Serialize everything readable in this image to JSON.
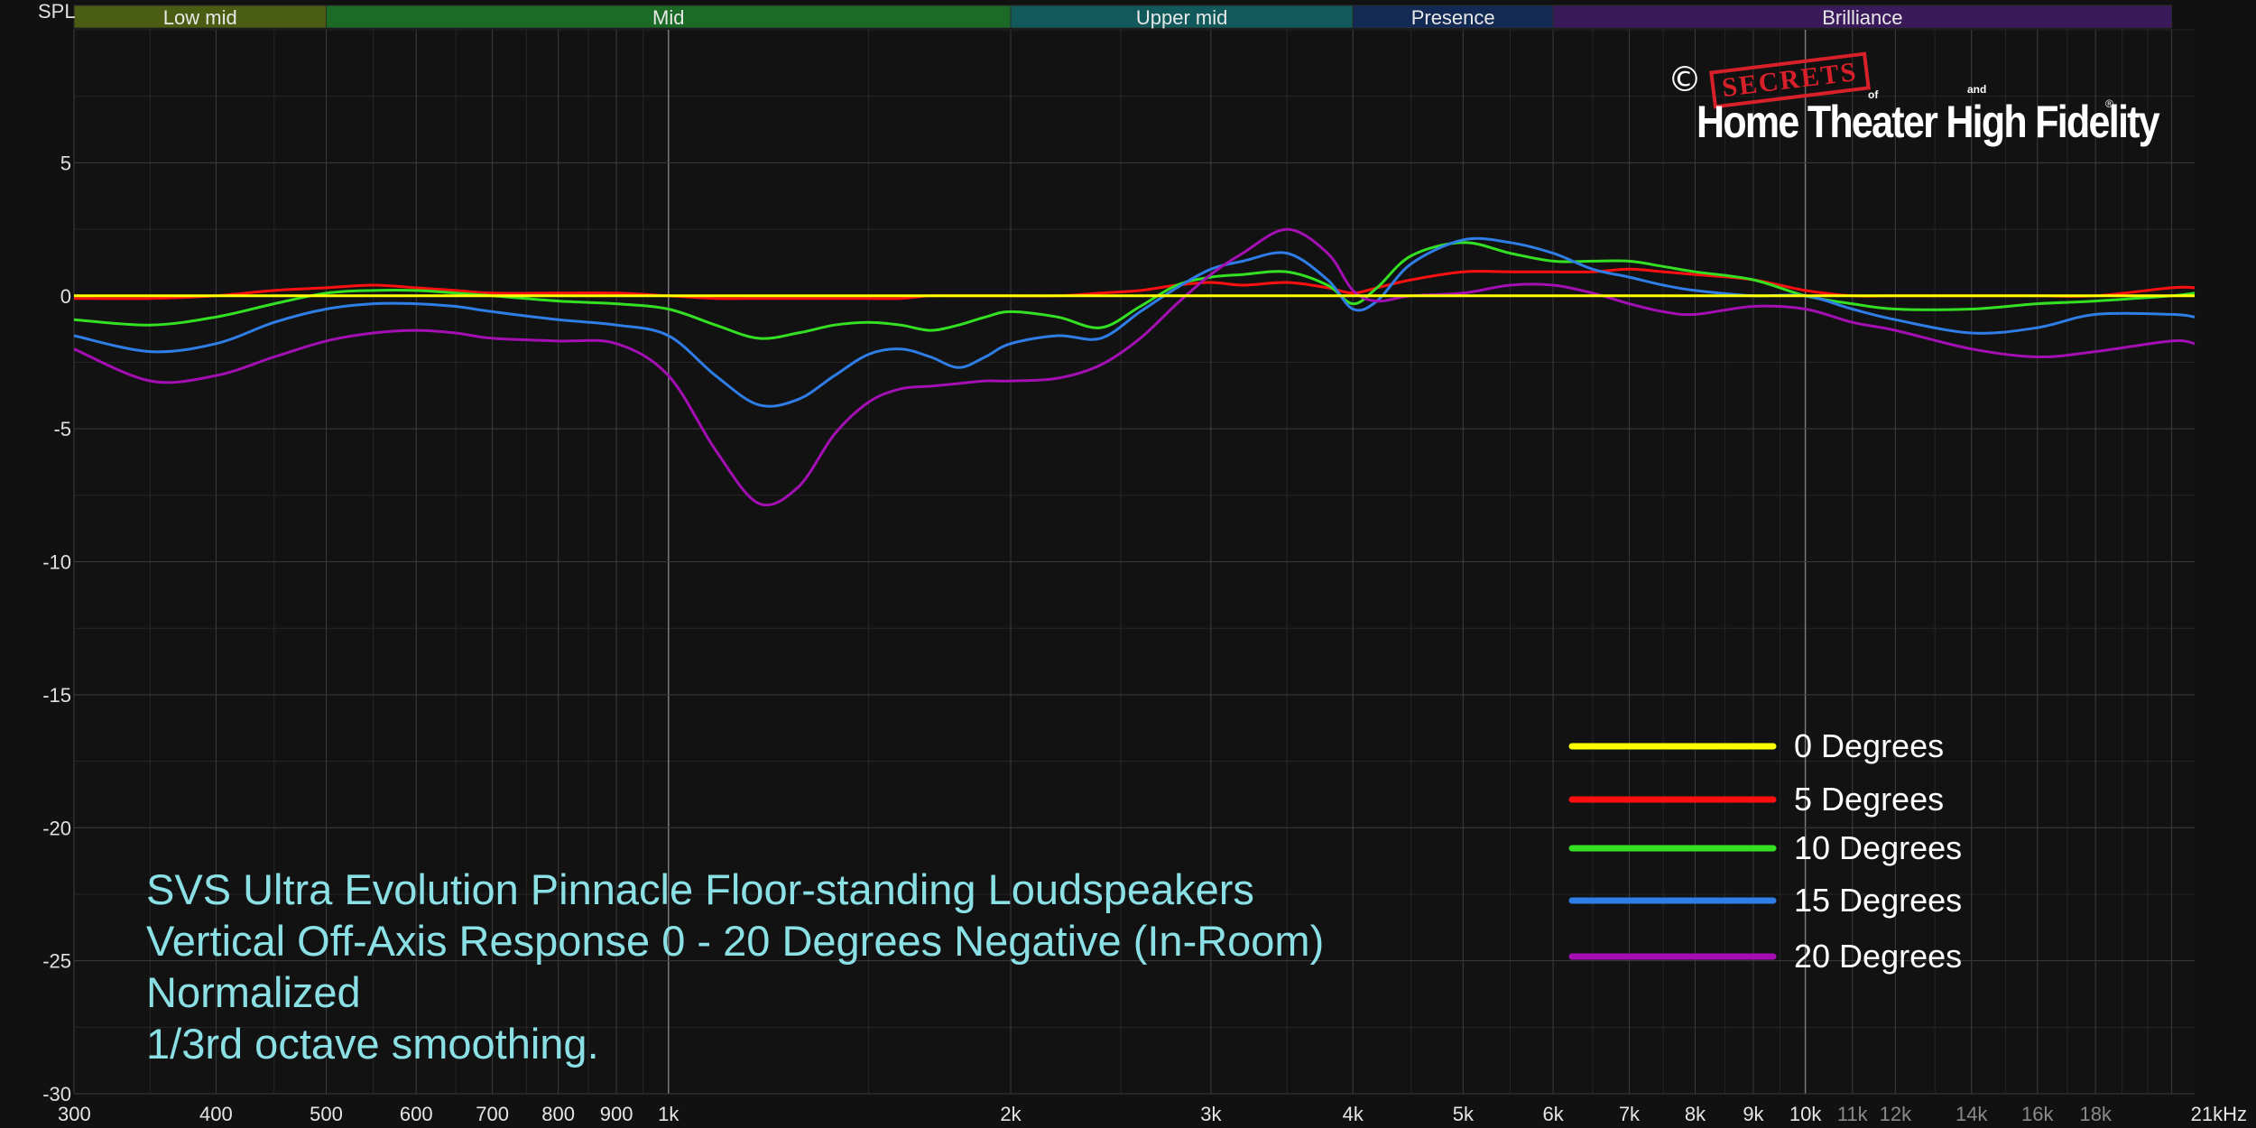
{
  "chart_data": {
    "type": "line",
    "ylabel": "SPL",
    "x_scale": "log",
    "xlim": [
      300,
      22000
    ],
    "ylim": [
      -30,
      10
    ],
    "grid": true,
    "x_ticks": [
      {
        "v": 300,
        "label": "300",
        "major": true
      },
      {
        "v": 400,
        "label": "400",
        "major": true
      },
      {
        "v": 500,
        "label": "500",
        "major": true
      },
      {
        "v": 600,
        "label": "600",
        "major": true
      },
      {
        "v": 700,
        "label": "700",
        "major": true
      },
      {
        "v": 800,
        "label": "800",
        "major": true
      },
      {
        "v": 900,
        "label": "900",
        "major": true
      },
      {
        "v": 1000,
        "label": "1k",
        "major": true
      },
      {
        "v": 2000,
        "label": "2k",
        "major": true
      },
      {
        "v": 3000,
        "label": "3k",
        "major": true
      },
      {
        "v": 4000,
        "label": "4k",
        "major": true
      },
      {
        "v": 5000,
        "label": "5k",
        "major": true
      },
      {
        "v": 6000,
        "label": "6k",
        "major": true
      },
      {
        "v": 7000,
        "label": "7k",
        "major": true
      },
      {
        "v": 8000,
        "label": "8k",
        "major": true
      },
      {
        "v": 9000,
        "label": "9k",
        "major": true
      },
      {
        "v": 10000,
        "label": "10k",
        "major": true
      },
      {
        "v": 11000,
        "label": "11k",
        "major": false
      },
      {
        "v": 12000,
        "label": "12k",
        "major": false
      },
      {
        "v": 14000,
        "label": "14k",
        "major": false
      },
      {
        "v": 16000,
        "label": "16k",
        "major": false
      },
      {
        "v": 18000,
        "label": "18k",
        "major": false
      },
      {
        "v": 21000,
        "label": "21kHz",
        "major": true
      }
    ],
    "y_ticks": [
      {
        "v": 5,
        "label": "5"
      },
      {
        "v": 0,
        "label": "0"
      },
      {
        "v": -5,
        "label": "-5"
      },
      {
        "v": -10,
        "label": "-10"
      },
      {
        "v": -15,
        "label": "-15"
      },
      {
        "v": -20,
        "label": "-20"
      },
      {
        "v": -25,
        "label": "-25"
      },
      {
        "v": -30,
        "label": "-30"
      }
    ],
    "bands": [
      {
        "label": "Low mid",
        "from": 300,
        "to": 500,
        "color": "#4a5d12"
      },
      {
        "label": "Mid",
        "from": 500,
        "to": 2000,
        "color": "#1b6a26"
      },
      {
        "label": "Upper mid",
        "from": 2000,
        "to": 4000,
        "color": "#11595a"
      },
      {
        "label": "Presence",
        "from": 4000,
        "to": 6000,
        "color": "#132a55"
      },
      {
        "label": "Brilliance",
        "from": 6000,
        "to": 21000,
        "color": "#3a1a5a"
      }
    ],
    "x": [
      300,
      350,
      400,
      450,
      500,
      550,
      600,
      650,
      700,
      800,
      900,
      1000,
      1100,
      1200,
      1300,
      1400,
      1500,
      1600,
      1700,
      1800,
      1900,
      2000,
      2200,
      2400,
      2600,
      2800,
      3000,
      3200,
      3500,
      3800,
      4000,
      4200,
      4500,
      5000,
      5500,
      6000,
      6500,
      7000,
      7500,
      8000,
      9000,
      10000,
      11000,
      12000,
      14000,
      16000,
      18000,
      21000,
      22000
    ],
    "series": [
      {
        "name": "0 Degrees",
        "color": "#ffff00",
        "values": [
          0,
          0,
          0,
          0,
          0,
          0,
          0,
          0,
          0,
          0,
          0,
          0,
          0,
          0,
          0,
          0,
          0,
          0,
          0,
          0,
          0,
          0,
          0,
          0,
          0,
          0,
          0,
          0,
          0,
          0,
          0,
          0,
          0,
          0,
          0,
          0,
          0,
          0,
          0,
          0,
          0,
          0,
          0,
          0,
          0,
          0,
          0,
          0,
          0
        ]
      },
      {
        "name": "5 Degrees",
        "color": "#ff1010",
        "values": [
          -0.1,
          -0.1,
          0.0,
          0.2,
          0.3,
          0.4,
          0.3,
          0.2,
          0.1,
          0.1,
          0.1,
          0.0,
          -0.1,
          -0.1,
          -0.1,
          -0.1,
          -0.1,
          -0.1,
          0.0,
          0.0,
          0.0,
          0.0,
          0.0,
          0.1,
          0.2,
          0.4,
          0.5,
          0.4,
          0.5,
          0.3,
          0.1,
          0.3,
          0.6,
          0.9,
          0.9,
          0.9,
          0.9,
          1.0,
          0.9,
          0.8,
          0.6,
          0.2,
          0.0,
          0.0,
          0.0,
          0.0,
          0.0,
          0.3,
          0.3
        ]
      },
      {
        "name": "10 Degrees",
        "color": "#33e022",
        "values": [
          -0.9,
          -1.1,
          -0.8,
          -0.3,
          0.1,
          0.2,
          0.2,
          0.1,
          0.0,
          -0.2,
          -0.3,
          -0.5,
          -1.1,
          -1.6,
          -1.4,
          -1.1,
          -1.0,
          -1.1,
          -1.3,
          -1.1,
          -0.8,
          -0.6,
          -0.8,
          -1.2,
          -0.4,
          0.4,
          0.7,
          0.8,
          0.9,
          0.4,
          -0.3,
          0.3,
          1.5,
          2.0,
          1.6,
          1.3,
          1.3,
          1.3,
          1.1,
          0.9,
          0.6,
          0.0,
          -0.3,
          -0.5,
          -0.5,
          -0.3,
          -0.2,
          0.0,
          0.1
        ]
      },
      {
        "name": "15 Degrees",
        "color": "#2f7de6",
        "values": [
          -1.5,
          -2.1,
          -1.8,
          -1.0,
          -0.5,
          -0.3,
          -0.3,
          -0.4,
          -0.6,
          -0.9,
          -1.1,
          -1.5,
          -3.0,
          -4.1,
          -3.9,
          -3.0,
          -2.2,
          -2.0,
          -2.3,
          -2.7,
          -2.3,
          -1.8,
          -1.5,
          -1.6,
          -0.6,
          0.3,
          1.0,
          1.3,
          1.6,
          0.6,
          -0.5,
          -0.2,
          1.2,
          2.1,
          2.0,
          1.6,
          1.0,
          0.7,
          0.4,
          0.2,
          0.0,
          0.0,
          -0.5,
          -0.9,
          -1.4,
          -1.2,
          -0.7,
          -0.7,
          -0.8
        ]
      },
      {
        "name": "20 Degrees",
        "color": "#a40fb4",
        "values": [
          -2.0,
          -3.2,
          -3.0,
          -2.3,
          -1.7,
          -1.4,
          -1.3,
          -1.4,
          -1.6,
          -1.7,
          -1.8,
          -3.0,
          -5.8,
          -7.8,
          -7.2,
          -5.2,
          -4.0,
          -3.5,
          -3.4,
          -3.3,
          -3.2,
          -3.2,
          -3.1,
          -2.6,
          -1.6,
          -0.3,
          0.8,
          1.6,
          2.5,
          1.6,
          0.2,
          -0.2,
          0.0,
          0.1,
          0.4,
          0.4,
          0.1,
          -0.3,
          -0.6,
          -0.7,
          -0.4,
          -0.5,
          -1.0,
          -1.3,
          -2.0,
          -2.3,
          -2.1,
          -1.7,
          -1.8
        ]
      }
    ]
  },
  "legend": [
    {
      "label": "0 Degrees",
      "color": "#ffff00"
    },
    {
      "label": "5 Degrees",
      "color": "#ff1010"
    },
    {
      "label": "10 Degrees",
      "color": "#33e022"
    },
    {
      "label": "15 Degrees",
      "color": "#2f7de6"
    },
    {
      "label": "20 Degrees",
      "color": "#a40fb4"
    }
  ],
  "caption": {
    "line1": "SVS Ultra Evolution Pinnacle Floor-standing Loudspeakers",
    "line2": "Vertical Off-Axis Response 0 - 20 Degrees Negative (In-Room)",
    "line3": "Normalized",
    "line4": "1/3rd octave smoothing."
  },
  "logo": {
    "copyright": "©",
    "stamp": "SECRETS",
    "of": "of",
    "and": "and",
    "main": "Home Theater High Fidelity",
    "reg": "®"
  },
  "colors": {
    "background": "#111111",
    "caption": "#8ae0e4",
    "grid_major": "#3a3a3a",
    "grid_minor": "#262626"
  }
}
